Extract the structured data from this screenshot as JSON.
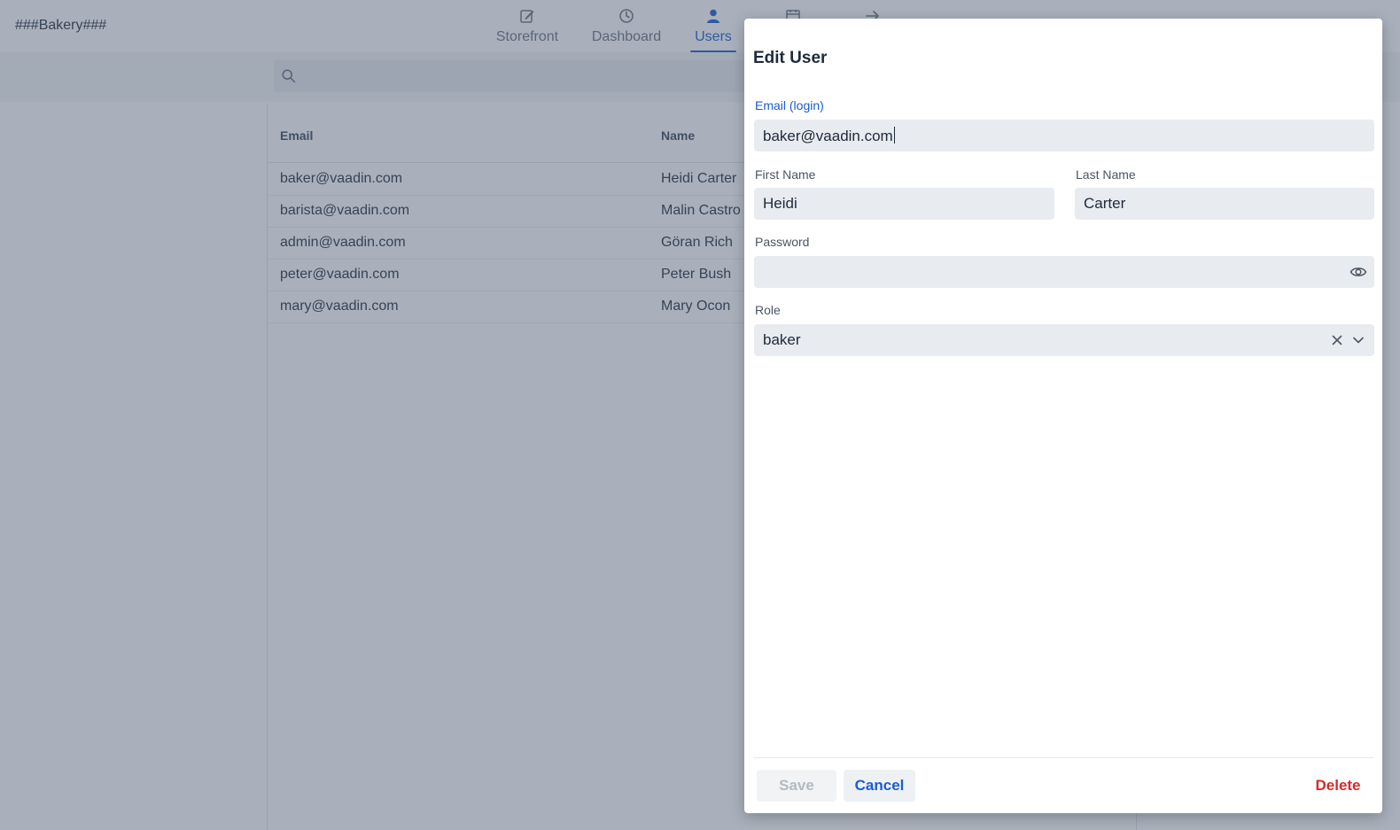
{
  "app": {
    "brand": "###Bakery###"
  },
  "nav": {
    "tabs": [
      {
        "label": "Storefront",
        "icon": "edit-icon"
      },
      {
        "label": "Dashboard",
        "icon": "clock-icon"
      },
      {
        "label": "Users",
        "icon": "user-icon",
        "active": true
      },
      {
        "label": "",
        "icon": "calendar-icon"
      },
      {
        "label": "",
        "icon": "arrow-right-icon"
      }
    ]
  },
  "search": {
    "placeholder": ""
  },
  "grid": {
    "columns": [
      "Email",
      "Name"
    ],
    "rows": [
      {
        "email": "baker@vaadin.com",
        "name": "Heidi Carter"
      },
      {
        "email": "barista@vaadin.com",
        "name": "Malin Castro"
      },
      {
        "email": "admin@vaadin.com",
        "name": "Göran Rich"
      },
      {
        "email": "peter@vaadin.com",
        "name": "Peter Bush"
      },
      {
        "email": "mary@vaadin.com",
        "name": "Mary Ocon"
      }
    ]
  },
  "dialog": {
    "title": "Edit User",
    "email_label": "Email (login)",
    "email_value": "baker@vaadin.com",
    "first_name_label": "First Name",
    "first_name_value": "Heidi",
    "last_name_label": "Last Name",
    "last_name_value": "Carter",
    "password_label": "Password",
    "password_value": "",
    "role_label": "Role",
    "role_value": "baker",
    "save_label": "Save",
    "cancel_label": "Cancel",
    "delete_label": "Delete"
  },
  "colors": {
    "accent": "#1a5dd0",
    "danger": "#d52a2a",
    "field_bg": "#e8ebef"
  }
}
